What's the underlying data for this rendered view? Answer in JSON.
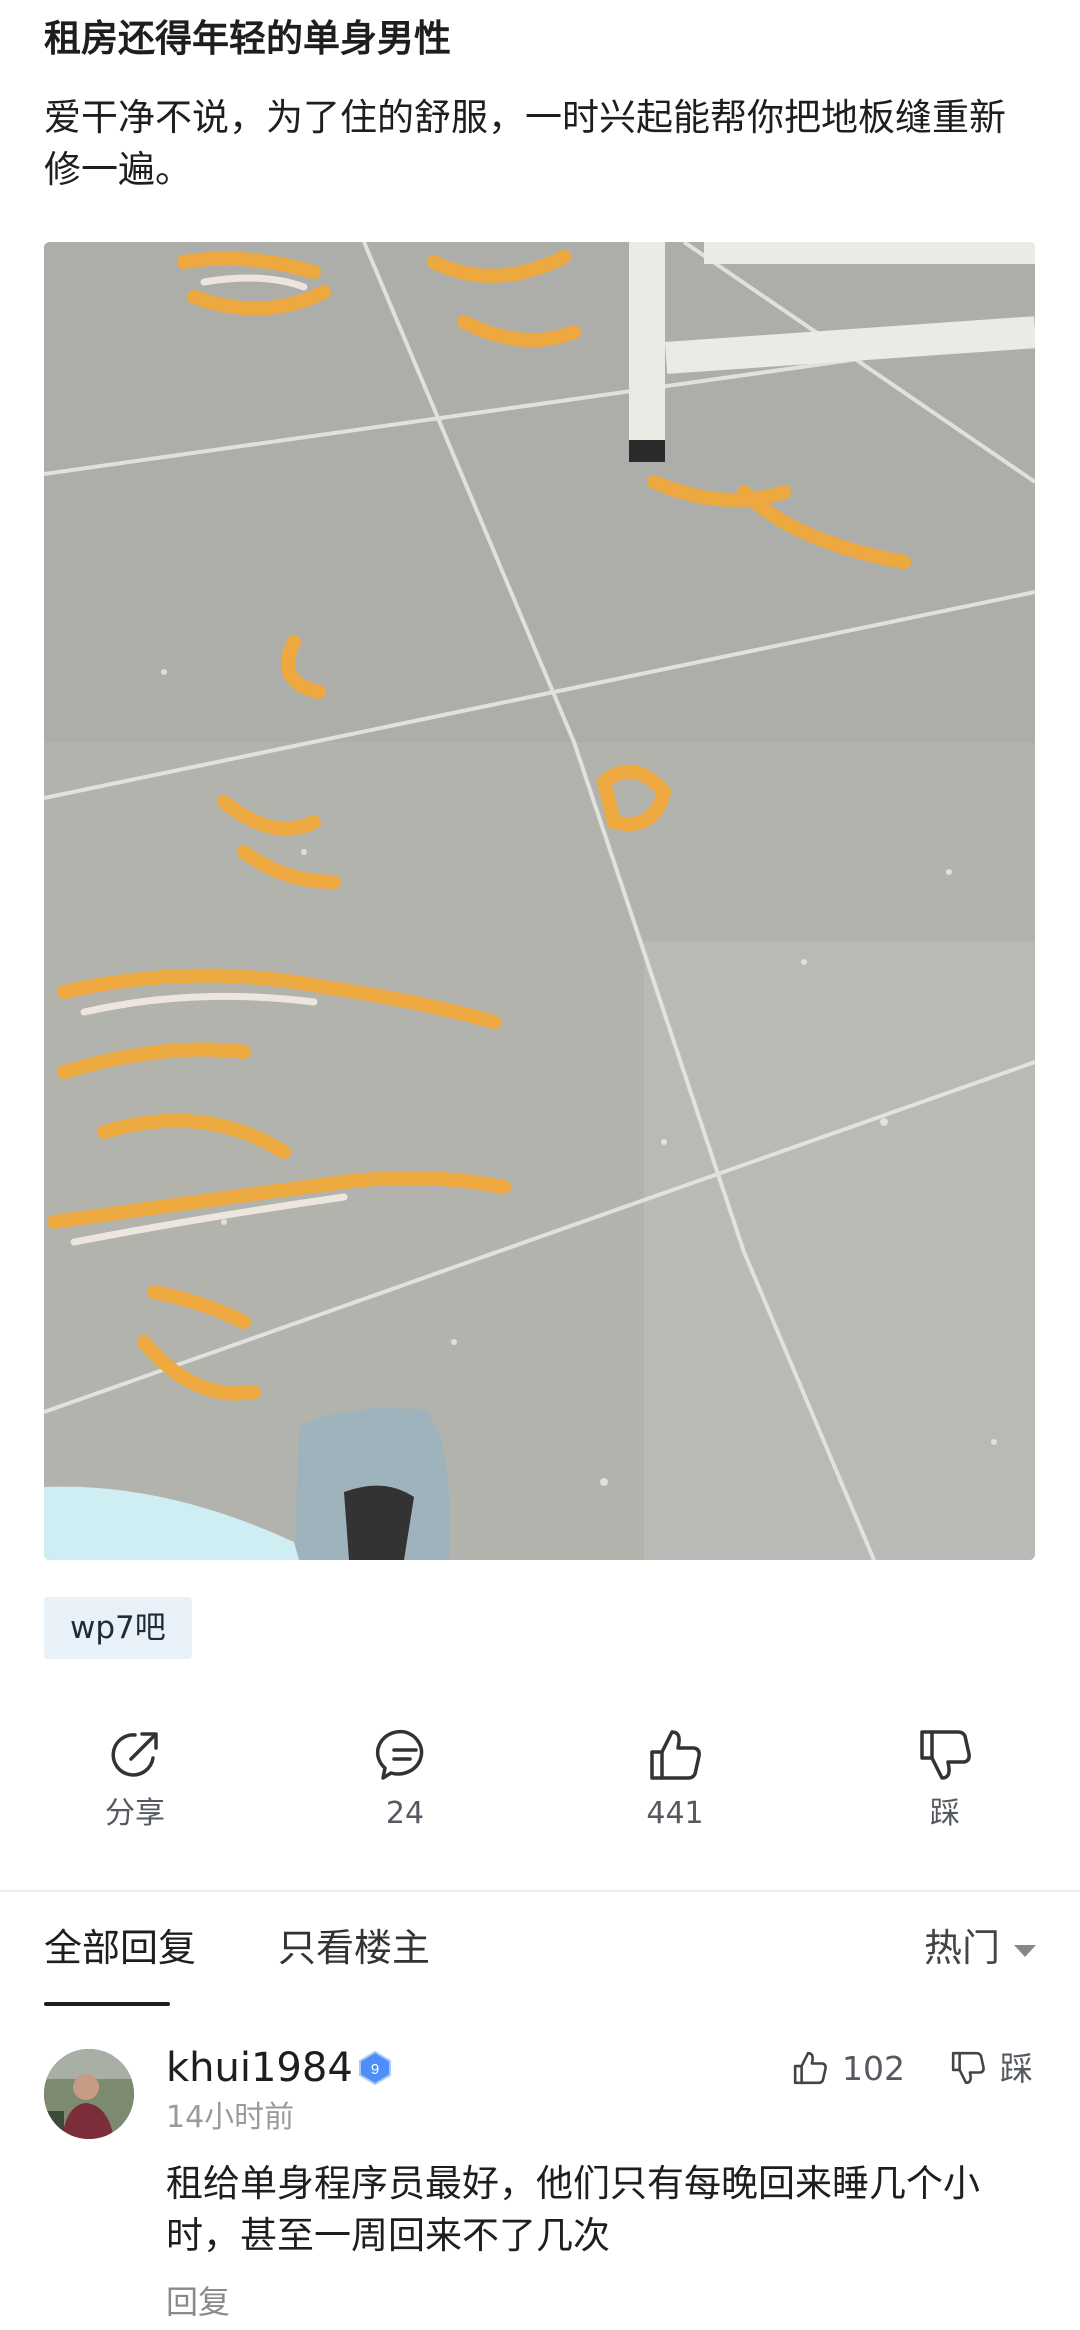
{
  "post": {
    "title": "租房还得年轻的单身男性",
    "body": "爱干净不说，为了住的舒服，一时兴起能帮你把地板缝重新修一遍。",
    "image_icon": "floor-tiles-with-masking-tape-photo",
    "forum_tag": "wp7吧"
  },
  "actions": {
    "share_label": "分享",
    "comment_count": "24",
    "like_count": "441",
    "dislike_label": "踩"
  },
  "tabs": {
    "all_replies": "全部回复",
    "owner_only": "只看楼主",
    "sort_label": "热门"
  },
  "comment": {
    "username": "khui1984",
    "level": "9",
    "time": "14小时前",
    "text": "租给单身程序员最好，他们只有每晚回来睡几个小时，甚至一周回来不了几次",
    "reply_label": "回复",
    "like_count": "102",
    "dislike_label": "踩"
  },
  "colors": {
    "tag_background": "#e8f0f8",
    "badge_blue": "#4f8ef7",
    "tape_orange": "#f0a93a"
  }
}
